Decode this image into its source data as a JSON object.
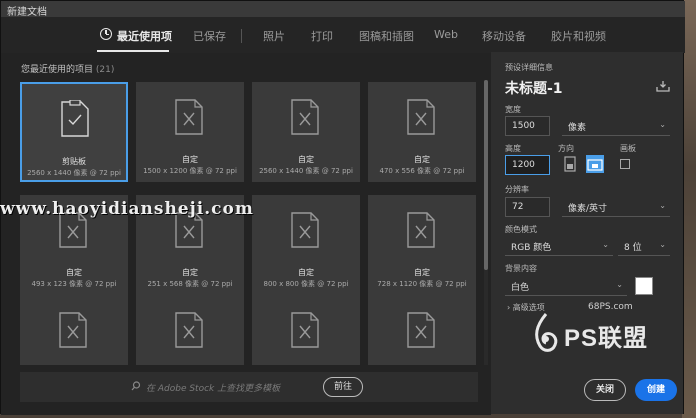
{
  "window": {
    "title": "新建文档"
  },
  "tabs": [
    {
      "label": "最近使用项",
      "active": true
    },
    {
      "label": "已保存"
    },
    {
      "label": "照片"
    },
    {
      "label": "打印"
    },
    {
      "label": "图稿和插图"
    },
    {
      "label": "Web"
    },
    {
      "label": "移动设备"
    },
    {
      "label": "胶片和视频"
    }
  ],
  "recent": {
    "title": "您最近使用的项目",
    "count": "(21)",
    "items": [
      {
        "name": "剪贴板",
        "size": "2560 x 1440 像素 @ 72 ppi",
        "selected": true,
        "icon": "check-document-icon"
      },
      {
        "name": "自定",
        "size": "1500 x 1200 像素 @ 72 ppi",
        "icon": "custom-document-icon"
      },
      {
        "name": "自定",
        "size": "2560 x 1440 像素 @ 72 ppi",
        "icon": "custom-document-icon"
      },
      {
        "name": "自定",
        "size": "470 x 556 像素 @ 72 ppi",
        "icon": "custom-document-icon"
      },
      {
        "name": "自定",
        "size": "493 x 123 像素 @ 72 ppi",
        "icon": "custom-document-icon"
      },
      {
        "name": "自定",
        "size": "251 x 568 像素 @ 72 ppi",
        "icon": "custom-document-icon"
      },
      {
        "name": "自定",
        "size": "800 x 800 像素 @ 72 ppi",
        "icon": "custom-document-icon"
      },
      {
        "name": "自定",
        "size": "728 x 1120 像素 @ 72 ppi",
        "icon": "custom-document-icon"
      },
      {
        "name": "",
        "size": "",
        "icon": "custom-document-icon"
      },
      {
        "name": "",
        "size": "",
        "icon": "custom-document-icon"
      },
      {
        "name": "",
        "size": "",
        "icon": "custom-document-icon"
      },
      {
        "name": "",
        "size": "",
        "icon": "custom-document-icon"
      }
    ]
  },
  "stock": {
    "placeholder": "在 Adobe Stock 上查找更多模板",
    "go_label": "前往"
  },
  "preset": {
    "section_label": "预设详细信息",
    "name": "未标题-1",
    "width_label": "宽度",
    "width_value": "1500",
    "width_unit": "像素",
    "height_label": "高度",
    "height_value": "1200",
    "orientation_label": "方向",
    "artboard_label": "画板",
    "resolution_label": "分辨率",
    "resolution_value": "72",
    "resolution_unit": "像素/英寸",
    "color_mode_label": "颜色模式",
    "color_mode_value": "RGB 颜色",
    "bit_depth_value": "8 位",
    "background_label": "背景内容",
    "background_value": "白色",
    "background_color": "#ffffff",
    "advanced_label": "高级选项"
  },
  "buttons": {
    "close_label": "关闭",
    "create_label": "创建"
  },
  "watermark": {
    "text": "www.haoyidiansheji.com"
  },
  "logo": {
    "site": "68PS.com",
    "brand": "PS联盟"
  },
  "colors": {
    "accent": "#1a73e8",
    "selection": "#4a9ee8"
  }
}
